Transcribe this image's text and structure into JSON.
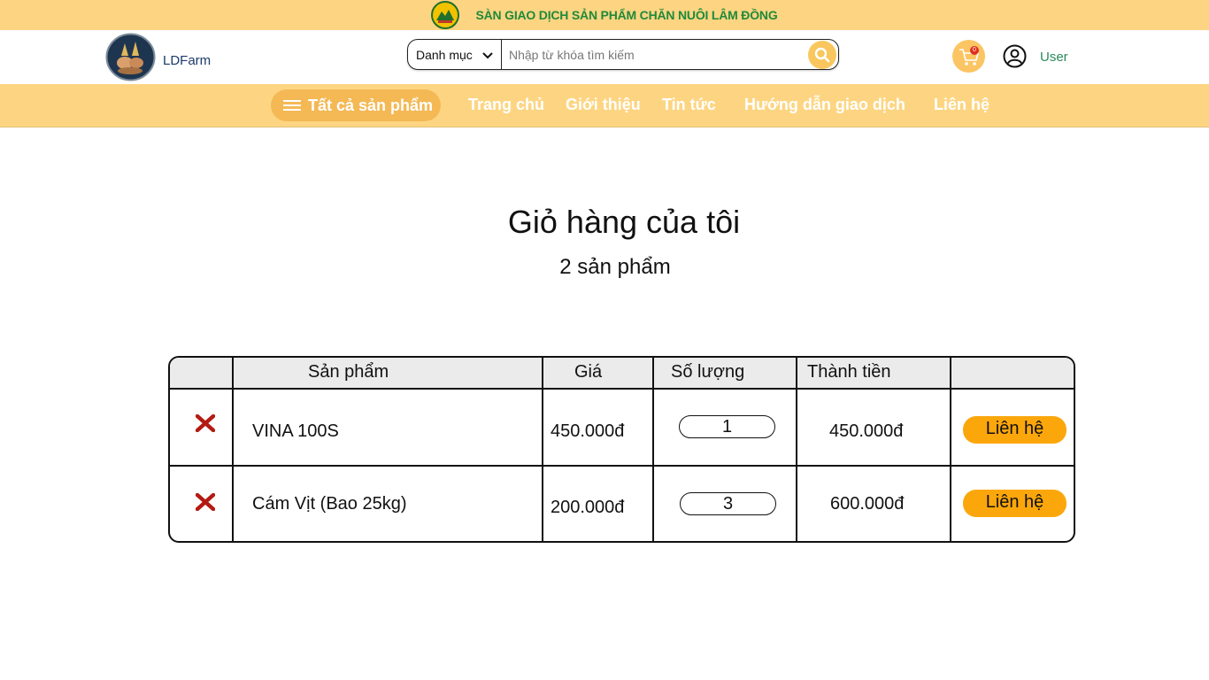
{
  "banner": {
    "text": "SÀN GIAO DỊCH SẢN PHẨM CHĂN NUÔI LÂM ĐỒNG",
    "emblem_icon": "provincial-emblem-icon"
  },
  "header": {
    "brand": "LDFarm",
    "search": {
      "category_label": "Danh mục",
      "placeholder": "Nhập từ khóa tìm kiếm",
      "value": ""
    },
    "cart_count": "0",
    "user_label": "User"
  },
  "nav": {
    "all_products": "Tất cả sản phẩm",
    "links": [
      "Trang chủ",
      "Giới thiệu",
      "Tin tức",
      "Hướng dẫn giao dịch",
      "Liên hệ"
    ]
  },
  "cart": {
    "title": "Giỏ hàng của tôi",
    "count_text": "2 sản phẩm",
    "columns": [
      "",
      "Sản phẩm",
      "Giá",
      "Số lượng",
      "Thành tiền",
      ""
    ],
    "rows": [
      {
        "name": "VINA 100S",
        "price": "450.000đ",
        "quantity": "1",
        "total": "450.000đ",
        "action": "Liên hệ"
      },
      {
        "name": "Cám Vịt (Bao 25kg)",
        "price": "200.000đ",
        "quantity": "3",
        "total": "600.000đ",
        "action": "Liên hệ"
      }
    ]
  },
  "colors": {
    "banner_bg": "#fdd582",
    "accent": "#f4b955",
    "button": "#fba70c",
    "remove": "#b31b12",
    "banner_text": "#1f8a3a"
  }
}
